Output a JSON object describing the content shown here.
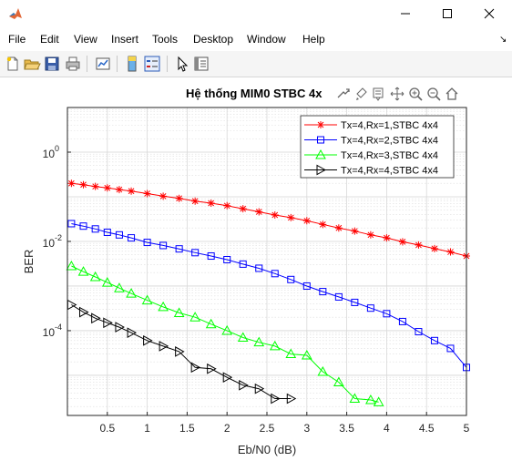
{
  "window": {
    "title": ""
  },
  "menu": [
    "File",
    "Edit",
    "View",
    "Insert",
    "Tools",
    "Desktop",
    "Window",
    "Help"
  ],
  "axes": {
    "title": "Hệ thống MIM0 STBC 4x"
  },
  "chart_data": {
    "type": "line",
    "title": "Hệ thống MIM0 STBC 4x",
    "xlabel": "Eb/N0 (dB)",
    "ylabel": "BER",
    "yscale": "log",
    "xlim": [
      0,
      5
    ],
    "ylim": [
      1.26e-06,
      10
    ],
    "grid": true,
    "legend_position": "top-right",
    "xticks": [
      "0.5",
      "1",
      "1.5",
      "2",
      "2.5",
      "3",
      "3.5",
      "4",
      "4.5",
      "5"
    ],
    "yticks": [
      {
        "base": "10",
        "exp": "0"
      },
      {
        "base": "10",
        "exp": "-2"
      },
      {
        "base": "10",
        "exp": "-4"
      }
    ],
    "series": [
      {
        "name": "Tx=4,Rx=1,STBC 4x4",
        "color": "#ff0000",
        "marker": "star",
        "x": [
          0.05,
          0.2,
          0.35,
          0.5,
          0.65,
          0.8,
          1,
          1.2,
          1.4,
          1.6,
          1.8,
          2,
          2.2,
          2.4,
          2.6,
          2.8,
          3,
          3.2,
          3.4,
          3.6,
          3.8,
          4,
          4.2,
          4.4,
          4.6,
          4.8,
          5
        ],
        "y": [
          0.2,
          0.186,
          0.17,
          0.158,
          0.145,
          0.134,
          0.118,
          0.103,
          0.092,
          0.08,
          0.072,
          0.063,
          0.054,
          0.046,
          0.039,
          0.034,
          0.029,
          0.024,
          0.02,
          0.017,
          0.014,
          0.012,
          0.0098,
          0.0083,
          0.0069,
          0.0058,
          0.0047
        ]
      },
      {
        "name": "Tx=4,Rx=2,STBC 4x4",
        "color": "#0000ff",
        "marker": "square",
        "x": [
          0.05,
          0.2,
          0.35,
          0.5,
          0.65,
          0.8,
          1,
          1.2,
          1.4,
          1.6,
          1.8,
          2,
          2.2,
          2.4,
          2.6,
          2.8,
          3,
          3.2,
          3.4,
          3.6,
          3.8,
          4,
          4.2,
          4.4,
          4.6,
          4.8,
          5
        ],
        "y": [
          0.025,
          0.022,
          0.019,
          0.016,
          0.014,
          0.012,
          0.0095,
          0.0081,
          0.0068,
          0.0056,
          0.0047,
          0.0039,
          0.0031,
          0.0025,
          0.0019,
          0.0014,
          0.001,
          0.00075,
          0.00057,
          0.00043,
          0.00032,
          0.00024,
          0.00016,
          9.5e-05,
          6e-05,
          4e-05,
          1.5e-05
        ]
      },
      {
        "name": "Tx=4,Rx=3,STBC 4x4",
        "color": "#00ff00",
        "marker": "triangle-up",
        "x": [
          0.05,
          0.2,
          0.35,
          0.5,
          0.65,
          0.8,
          1,
          1.2,
          1.4,
          1.6,
          1.8,
          2,
          2.2,
          2.4,
          2.6,
          2.8,
          3,
          3.2,
          3.4,
          3.6,
          3.8,
          3.9
        ],
        "y": [
          0.0028,
          0.0021,
          0.0016,
          0.0012,
          0.0009,
          0.00068,
          0.00048,
          0.00034,
          0.00025,
          0.0002,
          0.00014,
          0.0001,
          7e-05,
          5.5e-05,
          4.5e-05,
          3e-05,
          2.8e-05,
          1.2e-05,
          7e-06,
          3e-06,
          2.8e-06,
          2.5e-06
        ]
      },
      {
        "name": "Tx=4,Rx=4,STBC 4x4",
        "color": "#000000",
        "marker": "triangle-right",
        "x": [
          0.05,
          0.2,
          0.35,
          0.5,
          0.65,
          0.8,
          1,
          1.2,
          1.4,
          1.6,
          1.8,
          2,
          2.2,
          2.4,
          2.6,
          2.8
        ],
        "y": [
          0.00038,
          0.00026,
          0.00019,
          0.00015,
          0.00012,
          9e-05,
          6e-05,
          4.5e-05,
          3.4e-05,
          1.5e-05,
          1.4e-05,
          9e-06,
          6e-06,
          5e-06,
          3e-06,
          3e-06
        ]
      }
    ]
  }
}
